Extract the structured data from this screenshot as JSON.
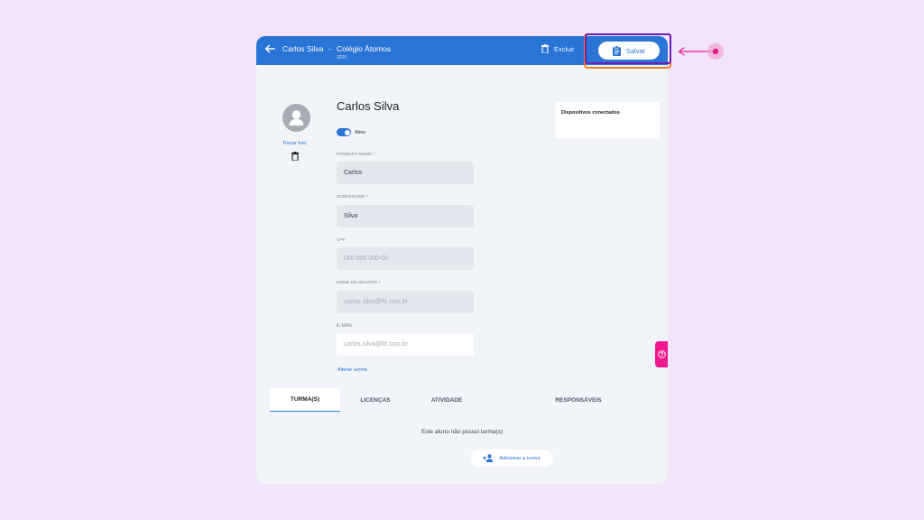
{
  "header": {
    "student_name": "Carlos Silva",
    "separator": "-",
    "school": "Colégio Átomos",
    "year": "2025",
    "delete_label": "Excluir",
    "save_label": "Salvar"
  },
  "profile": {
    "change_photo": "Trocar foto",
    "name": "Carlos Silva",
    "status_label": "Ativo",
    "status_active": true
  },
  "form": {
    "first_name_label": "PRIMEIRO NOME *",
    "first_name_value": "Carlos",
    "last_name_label": "SOBRENOME *",
    "last_name_value": "Silva",
    "cpf_label": "CPF",
    "cpf_placeholder": "000.000.000-00",
    "username_label": "NOME DE USUÁRIO *",
    "username_value": "carlos.silva@fd.com.br",
    "email_label": "E-MAIL",
    "email_value": "carlos.silva@fd.com.br",
    "change_password": "Alterar senha"
  },
  "devices": {
    "title": "Dispositivos conectados"
  },
  "tabs": [
    {
      "label": "TURMA(S)",
      "active": true
    },
    {
      "label": "LICENÇAS",
      "active": false
    },
    {
      "label": "ATIVIDADE",
      "active": false
    },
    {
      "label": "RESPONSÁVEIS",
      "active": false
    }
  ],
  "classes": {
    "empty_message": "Este aluno não possui turma(s)",
    "add_button": "Adicionar a turma"
  },
  "colors": {
    "primary": "#2a74d6",
    "background": "#f1e4fb",
    "highlight_inner": "#6a1fb8",
    "highlight_outer": "#ff7a1f",
    "pointer": "#e91e8c"
  }
}
